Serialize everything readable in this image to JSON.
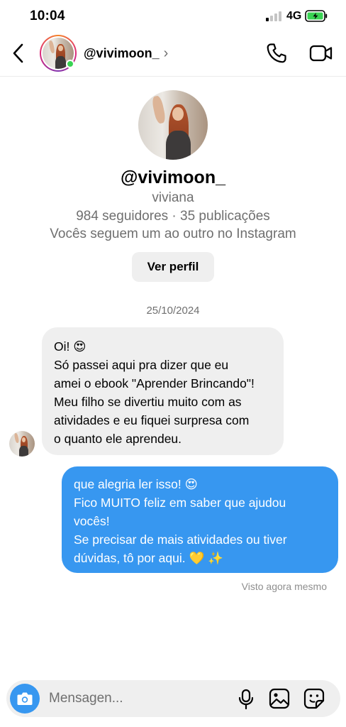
{
  "status_bar": {
    "time": "10:04",
    "network": "4G"
  },
  "header": {
    "username": "@vivimoon_",
    "chevron": "›"
  },
  "profile": {
    "handle": "@vivimoon_",
    "name": "viviana",
    "stats": "984 seguidores · 35 publicações",
    "mutual": "Vocês seguem um ao outro no Instagram",
    "view_profile_label": "Ver perfil"
  },
  "date_divider": "25/10/2024",
  "messages": {
    "incoming": {
      "lines": [
        "Oi! 😍",
        "Só passei aqui pra dizer que eu",
        "amei o ebook \"Aprender Brincando\"!",
        "Meu filho se divertiu muito com as",
        "atividades e eu fiquei surpresa com",
        "o quanto ele aprendeu."
      ]
    },
    "outgoing": {
      "lines": [
        "que alegria ler isso! 😍",
        "Fico MUITO feliz em saber que ajudou",
        "vocês!",
        "Se precisar de mais atividades ou tiver",
        "dúvidas, tô por aqui. 💛 ✨"
      ]
    },
    "seen_status": "Visto agora mesmo"
  },
  "composer": {
    "placeholder": "Mensagen...",
    "value": ""
  },
  "icons": {
    "back": "chevron-left-icon",
    "call": "phone-icon",
    "video": "video-camera-icon",
    "camera": "camera-icon",
    "mic": "microphone-icon",
    "gallery": "image-icon",
    "sticker": "sticker-icon"
  },
  "colors": {
    "accent": "#3797f0",
    "bubble_incoming": "#efefef",
    "online": "#39d353",
    "battery_charging": "#39d353",
    "secondary_text": "#6f6f6f"
  }
}
